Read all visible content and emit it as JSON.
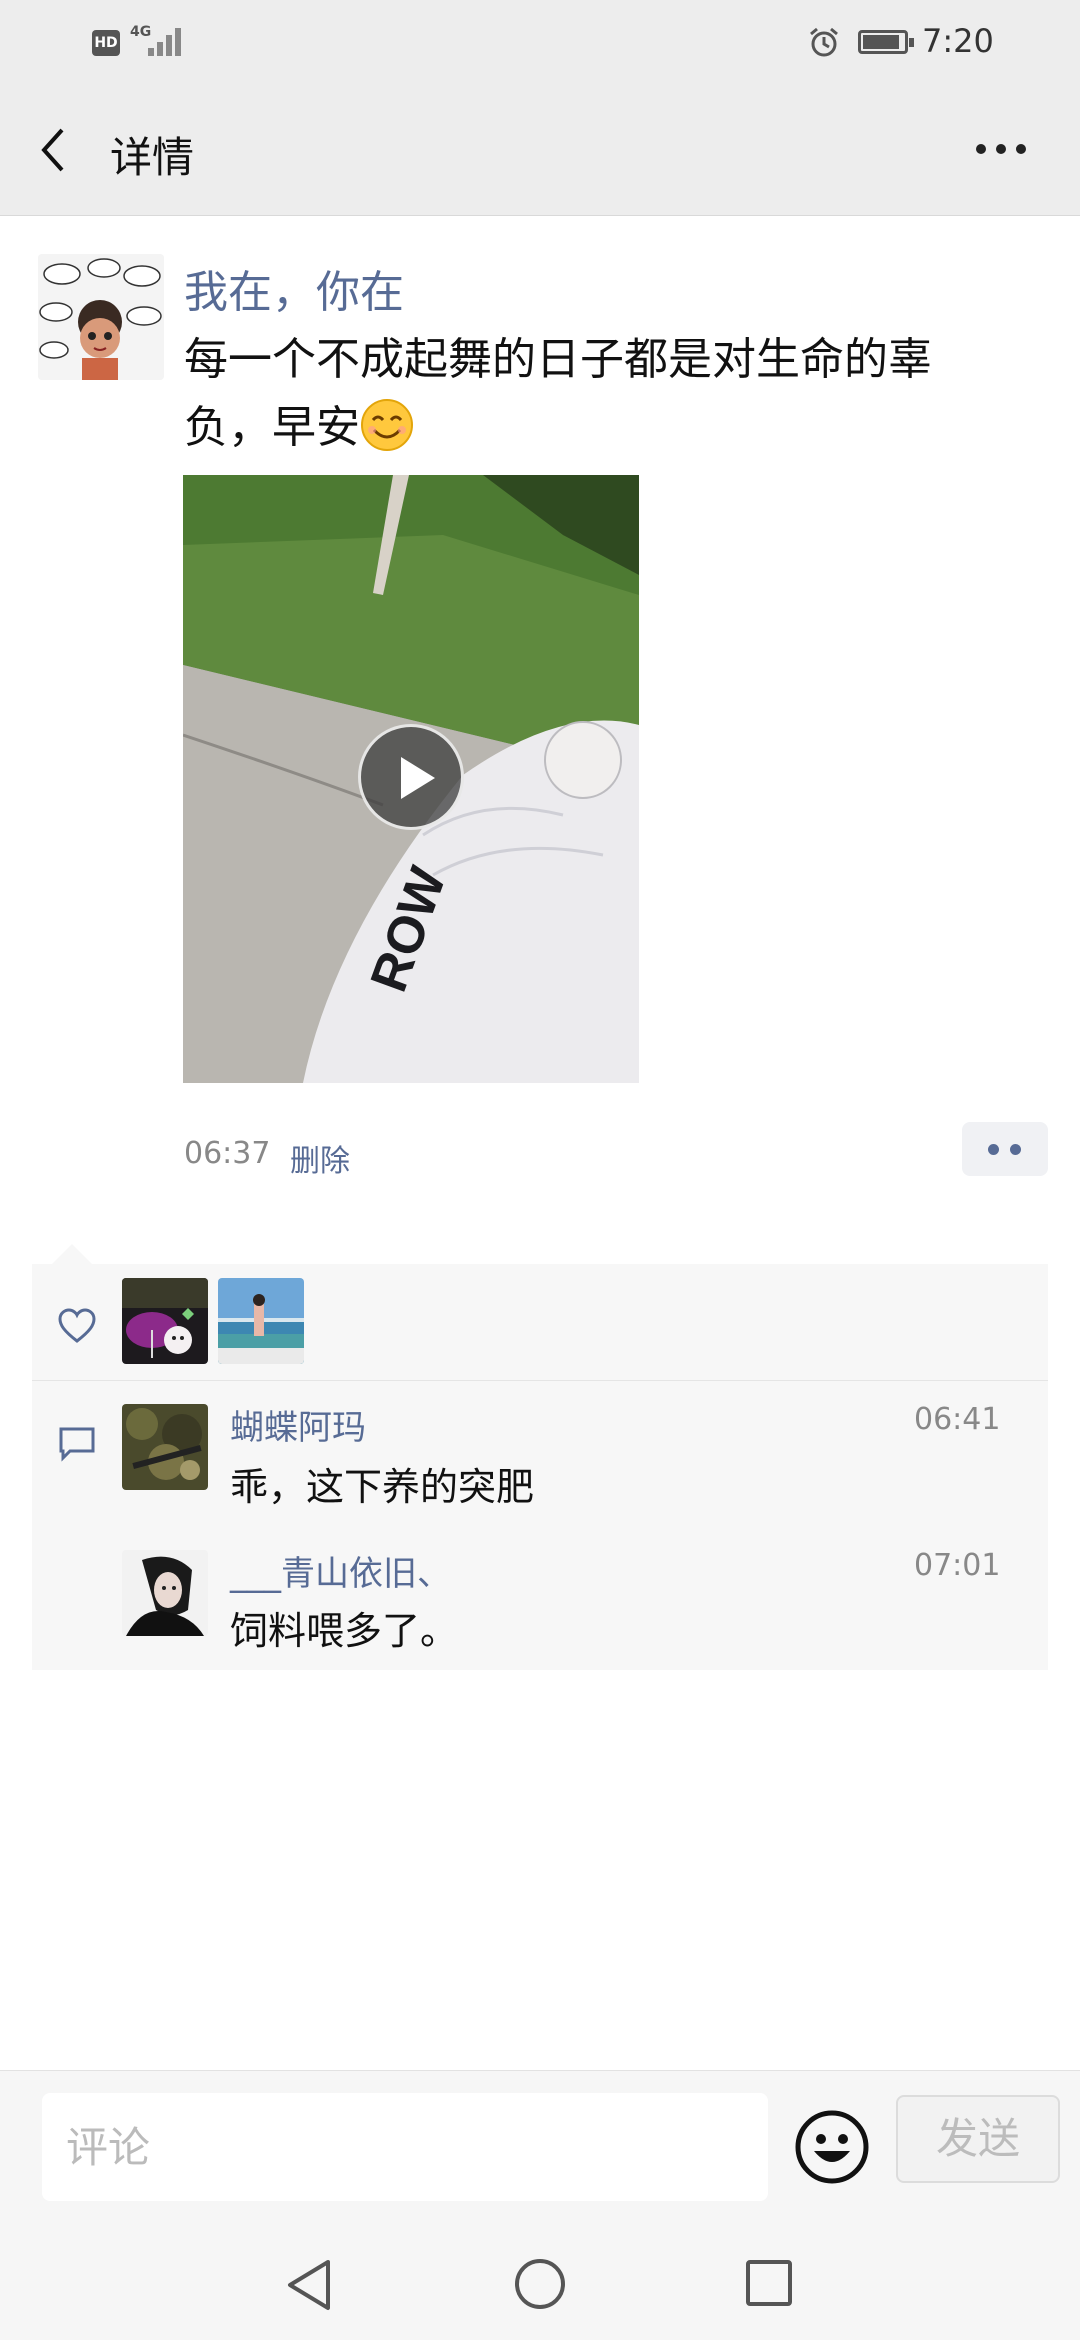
{
  "status_bar": {
    "network_type": "4G",
    "hd_label": "HD",
    "time": "7:20",
    "icons": [
      "hd-icon",
      "signal-icon",
      "alarm-icon",
      "battery-icon"
    ]
  },
  "nav": {
    "title": "详情",
    "back_icon": "chevron-left-icon",
    "more_icon": "more-horizontal-icon"
  },
  "post": {
    "author": "我在，你在",
    "text": "每一个不成起舞的日子都是对生命的辜负，早安",
    "emoji": "smile-emoji",
    "video_caption_text": "ROW",
    "time": "06:37",
    "delete_label": "删除"
  },
  "likes": {
    "icon": "heart-icon",
    "count": 2
  },
  "comments": [
    {
      "name": "蝴蝶阿玛",
      "text": "乖，这下养的突肥",
      "time": "06:41"
    },
    {
      "name": "___青山依旧、",
      "text": "饲料喂多了。",
      "time": "07:01"
    }
  ],
  "input": {
    "placeholder": "评论",
    "send_label": "发送",
    "emoji_icon": "emoji-smile-icon"
  },
  "colors": {
    "link": "#576b95",
    "bar_bg": "#ededed",
    "interact_bg": "#f7f7f7"
  }
}
